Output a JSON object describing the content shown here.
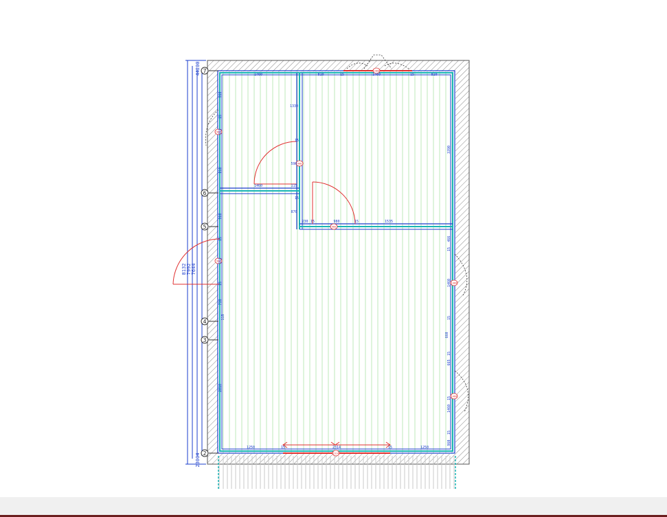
{
  "plan": {
    "axis_markers": [
      "7",
      "6",
      "5",
      "4",
      "3",
      "2"
    ],
    "overall_dimensions": [
      "44200",
      "8132",
      "7992",
      "7644",
      "23004"
    ],
    "top_wall_dims": [
      "1460",
      "810",
      "15",
      "1460",
      "15",
      "810"
    ],
    "left_wall_dims": [
      "960",
      "15",
      "460",
      "810",
      "960",
      "15",
      "960",
      "15",
      "730",
      "115",
      "2810"
    ],
    "right_wall_dims": [
      "3390",
      "466",
      "15",
      "1460",
      "15",
      "660",
      "15",
      "665",
      "15",
      "1460",
      "15",
      "960"
    ],
    "interior_wall_dims": [
      "1330",
      "15",
      "590",
      "1460",
      "115",
      "15",
      "870",
      "230",
      "15",
      "980",
      "15",
      "1535"
    ],
    "bottom_wall_dims": [
      "1250",
      "15",
      "2314",
      "15",
      "1250"
    ],
    "opening_tags": [
      "1460",
      "960",
      "960",
      "980",
      "980",
      "1460",
      "1460",
      "2314"
    ]
  },
  "colors": {
    "wall_blue": "#1a3ccc",
    "wall_cyan": "#18b5b5",
    "floor_green": "#bde9b8",
    "door_red": "#e03030",
    "hatch_gray": "#888888"
  }
}
